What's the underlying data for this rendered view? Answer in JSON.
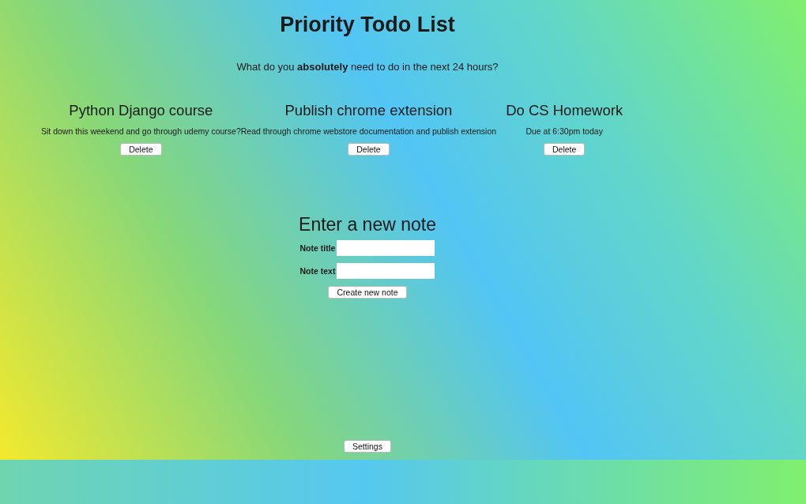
{
  "title": "Priority Todo List",
  "prompt": "What do you **absolutely** need to do in the next 24 hours?",
  "notes": [
    {
      "title": "Python Django course",
      "text": "Sit down this weekend and go through udemy course?",
      "button": "Delete"
    },
    {
      "title": "Publish chrome extension",
      "text": "Read through chrome webstore documentation and publish extension",
      "button": "Delete"
    },
    {
      "title": "Do CS Homework",
      "text": "Due at 6:30pm today",
      "button": "Delete"
    }
  ],
  "form": {
    "heading": "Enter a new note",
    "fields": [
      {
        "label": "Note title"
      },
      {
        "label": "Note text"
      }
    ],
    "button": "Create new note"
  },
  "settings_button": "Settings"
}
